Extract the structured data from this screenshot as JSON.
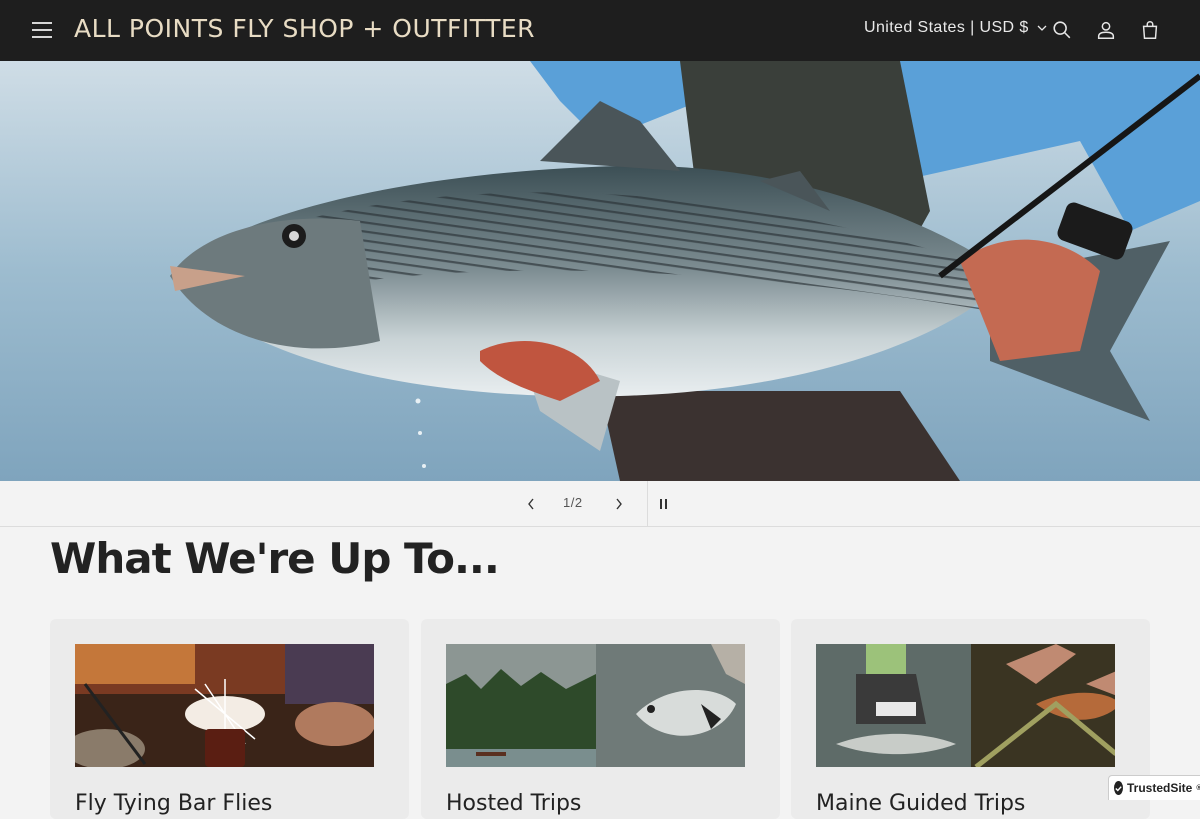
{
  "header": {
    "logo": "ALL POINTS FLY SHOP + OUTFITTER",
    "currency": "United States | USD $",
    "icons": [
      "menu-icon",
      "search-icon",
      "account-icon",
      "cart-icon"
    ]
  },
  "slider": {
    "counter": "1/2"
  },
  "section": {
    "title": "What We're Up To..."
  },
  "cards": [
    {
      "title": "Fly Tying Bar Flies"
    },
    {
      "title": "Hosted Trips"
    },
    {
      "title": "Maine Guided Trips"
    }
  ],
  "badge": {
    "label": "TrustedSite",
    "mark": "®"
  },
  "colors": {
    "header_bg": "#1e1e1e",
    "logo_color": "#e8dcc4",
    "page_bg": "#f3f3f3",
    "card_bg": "#ebebeb"
  }
}
